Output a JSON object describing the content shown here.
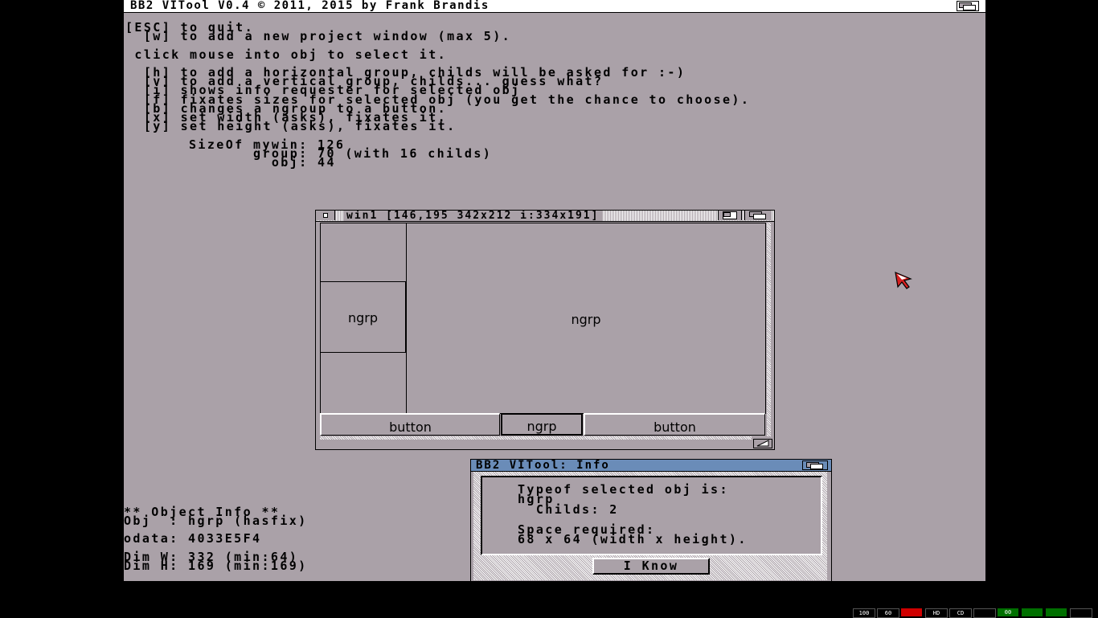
{
  "app": {
    "screen_title": "BB2 VITool V0.4 © 2011, 2015 by Frank Brandis"
  },
  "help_text": {
    "line1": "[ESC] to quit.",
    "line2": "  [w] to add a new project window (max 5).",
    "line3": " click mouse into obj to select it.",
    "line4": "  [h] to add a horizontal group, childs will be asked for :-)",
    "line5": "  [v] to add a vertical group, childs... guess what?",
    "line6": "  [i] shows info requester for selected obj",
    "line7": "  [f] fixates sizes for selected obj (you get the chance to choose).",
    "line8": "  [b] changes a ngroup to a button.",
    "line9": "  [x] set width (asks), fixates it.",
    "line10": "  [y] set height (asks), fixates it."
  },
  "sizeof": {
    "line1": "SizeOf mywin: 126",
    "line2": "       group: 70 (with 16 childs)",
    "line3": "         obj: 44"
  },
  "project_window": {
    "title": "win1 [146,195 342x212 i:334x191]",
    "left_box_label": "ngrp",
    "main_box_label": "ngrp",
    "button_left": "button",
    "button_middle": "ngrp",
    "button_right": "button"
  },
  "object_info": {
    "header": "** Object Info **",
    "obj": "Obj  : hgrp (hasfix)",
    "odata": "odata: 4033E5F4",
    "dim_w": "Dim W: 332 (min:64)",
    "dim_h": "Dim H: 169 (min:169)"
  },
  "info_requester": {
    "title": "BB2 VITool: Info",
    "line1": "Typeof selected obj is:",
    "line2": "hgrp",
    "line3": "  Childs: 2",
    "line4": "Space required:",
    "line5": "68 x 64 (width x height).",
    "ok_button": "I Know"
  },
  "status_indicators": {
    "i1": "100",
    "i2": "60",
    "i3": "",
    "i4": "HD",
    "i5": "CD",
    "i6": "",
    "i7": "00",
    "i8": "",
    "i9": "",
    "i10": ""
  },
  "colors": {
    "background": "#aaa1a8",
    "requester_title": "#6a8cb8",
    "power_led": "#d00000",
    "drive_led": "#007000"
  }
}
